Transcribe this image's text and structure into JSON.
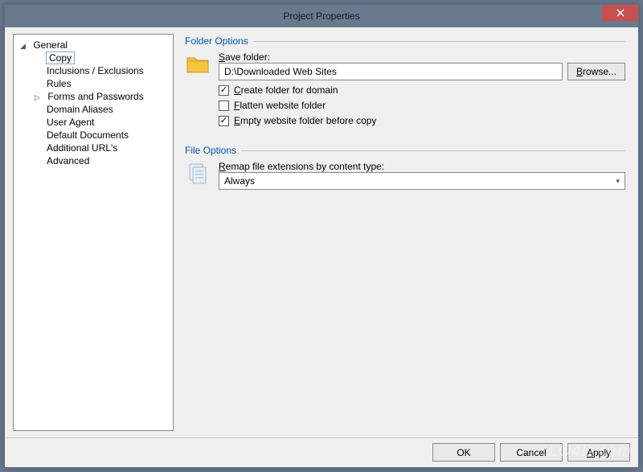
{
  "window": {
    "title": "Project Properties"
  },
  "tree": {
    "items": [
      {
        "label": "General",
        "level": 0,
        "expanded": true,
        "hasChildren": true
      },
      {
        "label": "Copy",
        "level": 1,
        "selected": true
      },
      {
        "label": "Inclusions / Exclusions",
        "level": 1
      },
      {
        "label": "Rules",
        "level": 1
      },
      {
        "label": "Forms and Passwords",
        "level": 1,
        "hasChildren": true,
        "expanded": false
      },
      {
        "label": "Domain Aliases",
        "level": 1
      },
      {
        "label": "User Agent",
        "level": 1
      },
      {
        "label": "Default Documents",
        "level": 1
      },
      {
        "label": "Additional URL's",
        "level": 1
      },
      {
        "label": "Advanced",
        "level": 1
      }
    ]
  },
  "folderOptions": {
    "title": "Folder Options",
    "saveFolderLabel": "Save folder:",
    "saveFolderValue": "D:\\Downloaded Web Sites",
    "browseLabel": "Browse...",
    "createFolder": {
      "label": "Create folder for domain",
      "checked": true
    },
    "flatten": {
      "label": "Flatten website folder",
      "checked": false
    },
    "empty": {
      "label": "Empty website folder before copy",
      "checked": true
    }
  },
  "fileOptions": {
    "title": "File Options",
    "remapLabel": "Remap file extensions by content type:",
    "remapValue": "Always"
  },
  "buttons": {
    "ok": "OK",
    "cancel": "Cancel",
    "apply": "Apply"
  },
  "mnemonics": {
    "saveFolder": "S",
    "browse": "B",
    "create": "C",
    "flatten": "F",
    "empty": "E",
    "remap": "R",
    "apply": "A"
  }
}
